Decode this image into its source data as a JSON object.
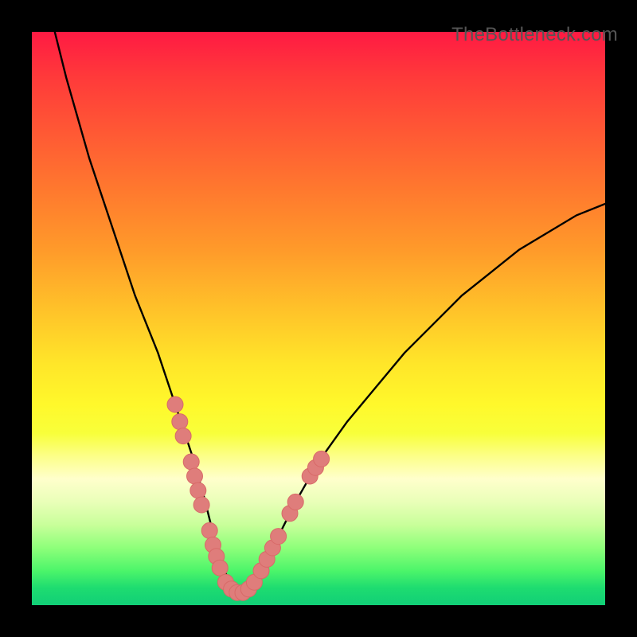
{
  "watermark": {
    "text": "TheBottleneck.com"
  },
  "colors": {
    "background": "#000000",
    "curve": "#000000",
    "marker_fill": "#df7d7b",
    "marker_stroke": "#d86a68"
  },
  "chart_data": {
    "type": "line",
    "title": "",
    "xlabel": "",
    "ylabel": "",
    "xlim": [
      0,
      100
    ],
    "ylim": [
      0,
      100
    ],
    "grid": false,
    "legend": false,
    "series": [
      {
        "name": "bottleneck-curve",
        "x": [
          4,
          6,
          8,
          10,
          12,
          14,
          16,
          18,
          20,
          22,
          24,
          26,
          28,
          30,
          31,
          32,
          33,
          34,
          35,
          36,
          37,
          38,
          40,
          42,
          44,
          46,
          50,
          55,
          60,
          65,
          70,
          75,
          80,
          85,
          90,
          95,
          100
        ],
        "y": [
          100,
          92,
          85,
          78,
          72,
          66,
          60,
          54,
          49,
          44,
          38,
          32,
          26,
          19,
          15,
          11,
          8,
          5,
          3,
          2,
          2,
          3,
          6,
          10,
          14,
          18,
          25,
          32,
          38,
          44,
          49,
          54,
          58,
          62,
          65,
          68,
          70
        ]
      }
    ],
    "markers": [
      {
        "name": "left-cluster-1",
        "x": 25.0,
        "y": 35.0
      },
      {
        "name": "left-cluster-2",
        "x": 25.8,
        "y": 32.0
      },
      {
        "name": "left-cluster-3",
        "x": 26.4,
        "y": 29.5
      },
      {
        "name": "left-cluster-4",
        "x": 27.8,
        "y": 25.0
      },
      {
        "name": "left-cluster-5",
        "x": 28.4,
        "y": 22.5
      },
      {
        "name": "left-cluster-6",
        "x": 29.0,
        "y": 20.0
      },
      {
        "name": "left-cluster-7",
        "x": 29.6,
        "y": 17.5
      },
      {
        "name": "left-cluster-8",
        "x": 31.0,
        "y": 13.0
      },
      {
        "name": "left-cluster-9",
        "x": 31.6,
        "y": 10.5
      },
      {
        "name": "left-cluster-10",
        "x": 32.2,
        "y": 8.5
      },
      {
        "name": "left-cluster-11",
        "x": 32.8,
        "y": 6.5
      },
      {
        "name": "bottom-1",
        "x": 33.8,
        "y": 4.0
      },
      {
        "name": "bottom-2",
        "x": 34.8,
        "y": 2.8
      },
      {
        "name": "bottom-3",
        "x": 35.8,
        "y": 2.2
      },
      {
        "name": "bottom-4",
        "x": 36.8,
        "y": 2.2
      },
      {
        "name": "bottom-5",
        "x": 37.8,
        "y": 2.8
      },
      {
        "name": "bottom-6",
        "x": 38.8,
        "y": 4.0
      },
      {
        "name": "right-cluster-1",
        "x": 40.0,
        "y": 6.0
      },
      {
        "name": "right-cluster-2",
        "x": 41.0,
        "y": 8.0
      },
      {
        "name": "right-cluster-3",
        "x": 42.0,
        "y": 10.0
      },
      {
        "name": "right-cluster-4",
        "x": 43.0,
        "y": 12.0
      },
      {
        "name": "right-cluster-5",
        "x": 45.0,
        "y": 16.0
      },
      {
        "name": "right-cluster-6",
        "x": 46.0,
        "y": 18.0
      },
      {
        "name": "right-cluster-7",
        "x": 48.5,
        "y": 22.5
      },
      {
        "name": "right-cluster-8",
        "x": 49.5,
        "y": 24.0
      },
      {
        "name": "right-cluster-9",
        "x": 50.5,
        "y": 25.5
      }
    ],
    "marker_radius_px": 10
  }
}
